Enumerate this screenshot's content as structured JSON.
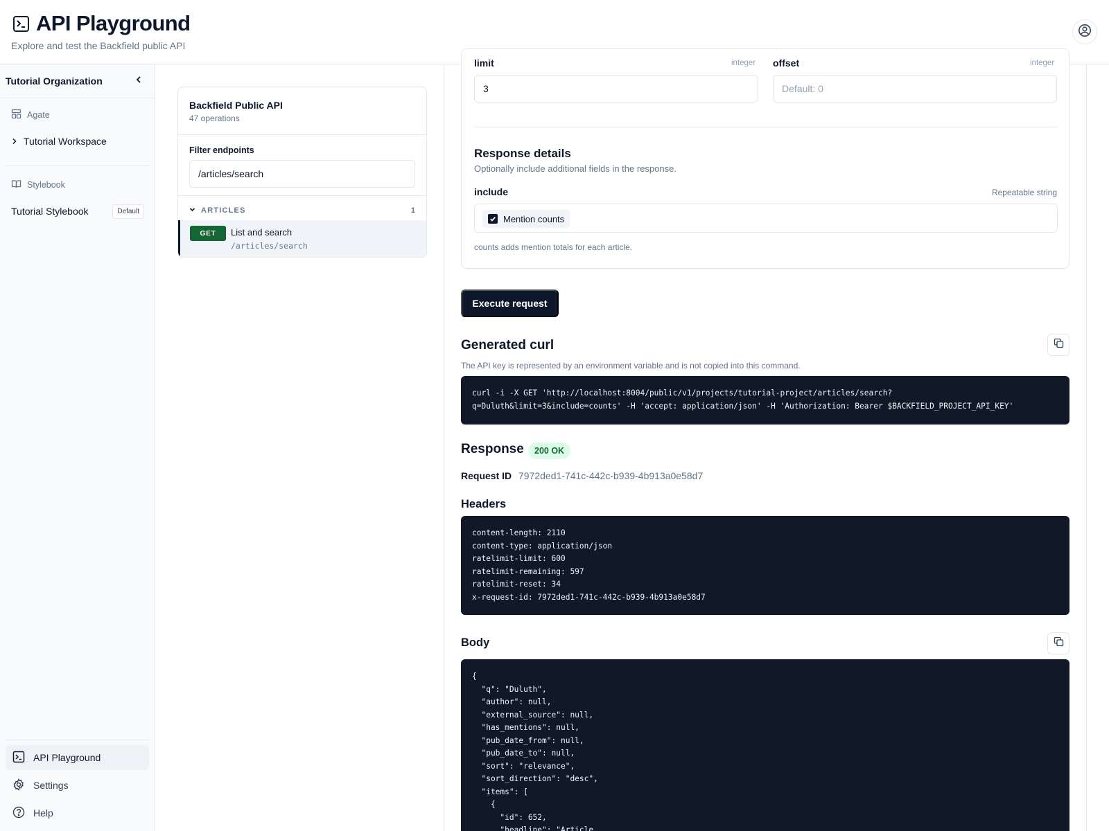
{
  "header": {
    "title": "API Playground",
    "subtitle": "Explore and test the Backfield public API",
    "icons": {
      "app": "terminal-icon",
      "account": "user-circle-icon"
    }
  },
  "sidebar": {
    "org_name": "Tutorial Organization",
    "workspace_section": "Agate",
    "workspace_item": "Tutorial Workspace",
    "stylebook_section": "Stylebook",
    "stylebook_item": "Tutorial Stylebook",
    "stylebook_badge": "Default",
    "nav": [
      {
        "label": "API Playground",
        "icon": "terminal-icon",
        "active": true
      },
      {
        "label": "Settings",
        "icon": "gear-icon",
        "active": false
      },
      {
        "label": "Help",
        "icon": "help-circle-icon",
        "active": false
      }
    ]
  },
  "endpoints": {
    "api_name": "Backfield Public API",
    "op_count": "47 operations",
    "filter_label": "Filter endpoints",
    "filter_value": "/articles/search",
    "group_name": "ARTICLES",
    "group_count": "1",
    "items": [
      {
        "method": "GET",
        "name": "List and search",
        "path": "/articles/search"
      }
    ]
  },
  "params": {
    "limit_label": "limit",
    "limit_type": "integer",
    "limit_value": "3",
    "offset_label": "offset",
    "offset_type": "integer",
    "offset_placeholder": "Default: 0",
    "response_details_title": "Response details",
    "response_details_sub": "Optionally include additional fields in the response.",
    "include_label": "include",
    "include_type": "Repeatable string",
    "include_option": "Mention counts",
    "include_checked": true,
    "include_help": "counts adds mention totals for each article."
  },
  "execute_label": "Execute request",
  "curl": {
    "title": "Generated curl",
    "note": "The API key is represented by an environment variable and is not copied into this command.",
    "command": "curl -i -X GET 'http://localhost:8004/public/v1/projects/tutorial-project/articles/search?\nq=Duluth&limit=3&include=counts' -H 'accept: application/json' -H 'Authorization: Bearer $BACKFIELD_PROJECT_API_KEY'"
  },
  "response": {
    "title": "Response",
    "status": "200 OK",
    "status_color": "#166534",
    "request_id_label": "Request ID",
    "request_id": "7972ded1-741c-442c-b939-4b913a0e58d7",
    "headers_title": "Headers",
    "headers_text": "content-length: 2110\ncontent-type: application/json\nratelimit-limit: 600\nratelimit-remaining: 597\nratelimit-reset: 34\nx-request-id: 7972ded1-741c-442c-b939-4b913a0e58d7",
    "body_title": "Body",
    "body_text": "{\n  \"q\": \"Duluth\",\n  \"author\": null,\n  \"external_source\": null,\n  \"has_mentions\": null,\n  \"pub_date_from\": null,\n  \"pub_date_to\": null,\n  \"sort\": \"relevance\",\n  \"sort_direction\": \"desc\",\n  \"items\": [\n    {\n      \"id\": 652,\n      \"headline\": \"Article"
  }
}
